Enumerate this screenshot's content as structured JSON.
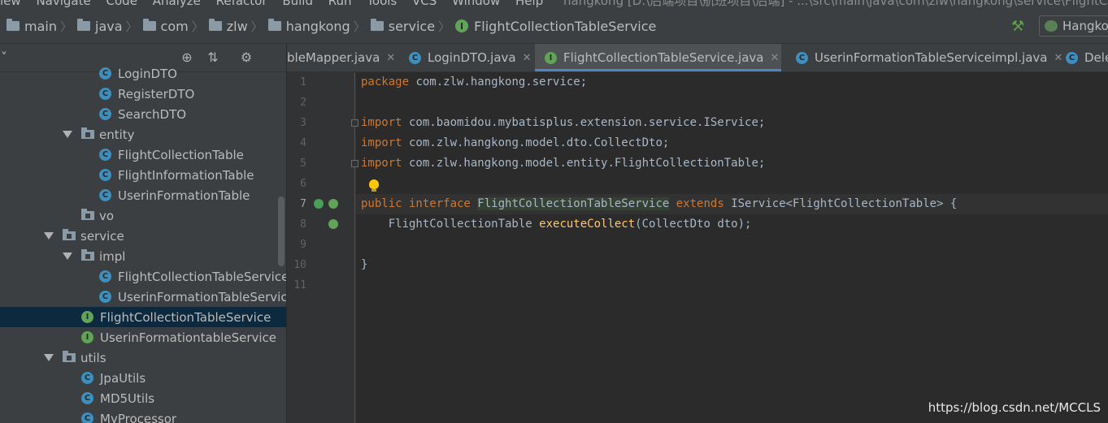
{
  "menubar": {
    "items": [
      "iew",
      "Navigate",
      "Code",
      "Analyze",
      "Refactor",
      "Build",
      "Run",
      "Tools",
      "VCS",
      "Window",
      "Help"
    ],
    "title": "hangkong [D:\\后端项目\\航班项目\\后端] - ...\\src\\main\\java\\com\\zlw\\hangkong\\service\\FlightCollectio"
  },
  "breadcrumb": {
    "items": [
      "main",
      "java",
      "com",
      "zlw",
      "hangkong",
      "service"
    ],
    "current": "FlightCollectionTableService"
  },
  "run_config": {
    "label": "Hangko"
  },
  "project_tree": {
    "items": [
      {
        "label": "LoginDTO",
        "type": "class"
      },
      {
        "label": "RegisterDTO",
        "type": "class"
      },
      {
        "label": "SearchDTO",
        "type": "class"
      },
      {
        "label": "entity",
        "type": "folder",
        "expanded": true
      },
      {
        "label": "FlightCollectionTable",
        "type": "class"
      },
      {
        "label": "FlightInformationTable",
        "type": "class"
      },
      {
        "label": "UserinFormationTable",
        "type": "class"
      },
      {
        "label": "vo",
        "type": "folder",
        "expanded": false
      },
      {
        "label": "service",
        "type": "folder",
        "expanded": true
      },
      {
        "label": "impl",
        "type": "folder",
        "expanded": true
      },
      {
        "label": "FlightCollectionTableService",
        "type": "class"
      },
      {
        "label": "UserinFormationTableServic",
        "type": "class"
      },
      {
        "label": "FlightCollectionTableService",
        "type": "interface",
        "selected": true
      },
      {
        "label": "UserinFormationtableService",
        "type": "interface"
      },
      {
        "label": "utils",
        "type": "folder",
        "expanded": true
      },
      {
        "label": "JpaUtils",
        "type": "class"
      },
      {
        "label": "MD5Utils",
        "type": "class"
      },
      {
        "label": "MyProcessor",
        "type": "class"
      }
    ]
  },
  "tabs": [
    {
      "label": "bleMapper.java",
      "icon": "none"
    },
    {
      "label": "LoginDTO.java",
      "icon": "class"
    },
    {
      "label": "FlightCollectionTableService.java",
      "icon": "interface",
      "active": true
    },
    {
      "label": "UserinFormationTableServiceimpl.java",
      "icon": "class"
    },
    {
      "label": "Dele",
      "icon": "class"
    }
  ],
  "editor": {
    "line_numbers": [
      "1",
      "2",
      "3",
      "4",
      "5",
      "6",
      "7",
      "8",
      "9",
      "10",
      "11"
    ],
    "current_line": "7",
    "lines": {
      "l1_kw": "package",
      "l1_rest": " com.zlw.hangkong.service;",
      "l3_kw": "import",
      "l3_rest": " com.baomidou.mybatisplus.extension.service.IService;",
      "l4_kw": "import",
      "l4_rest": " com.zlw.hangkong.model.dto.CollectDto;",
      "l5_kw": "import",
      "l5_rest": " com.zlw.hangkong.model.entity.FlightCollectionTable;",
      "l7_kw1": "public interface",
      "l7_name": "FlightCollectionTableService",
      "l7_kw2": "extends",
      "l7_rest": " IService<FlightCollectionTable> {",
      "l8_pre": "    FlightCollectionTable ",
      "l8_fn": "executeCollect",
      "l8_rest": "(CollectDto dto);",
      "l10": "}"
    }
  },
  "watermark": "https://blog.csdn.net/MCCLS",
  "colors": {
    "keyword": "#cc7832",
    "method": "#ffc66d",
    "text": "#a9b7c6",
    "selection": "#0d293e",
    "tab_underline": "#4a88c7",
    "interface_icon": "#62a35a",
    "class_icon": "#3d8fbf"
  }
}
